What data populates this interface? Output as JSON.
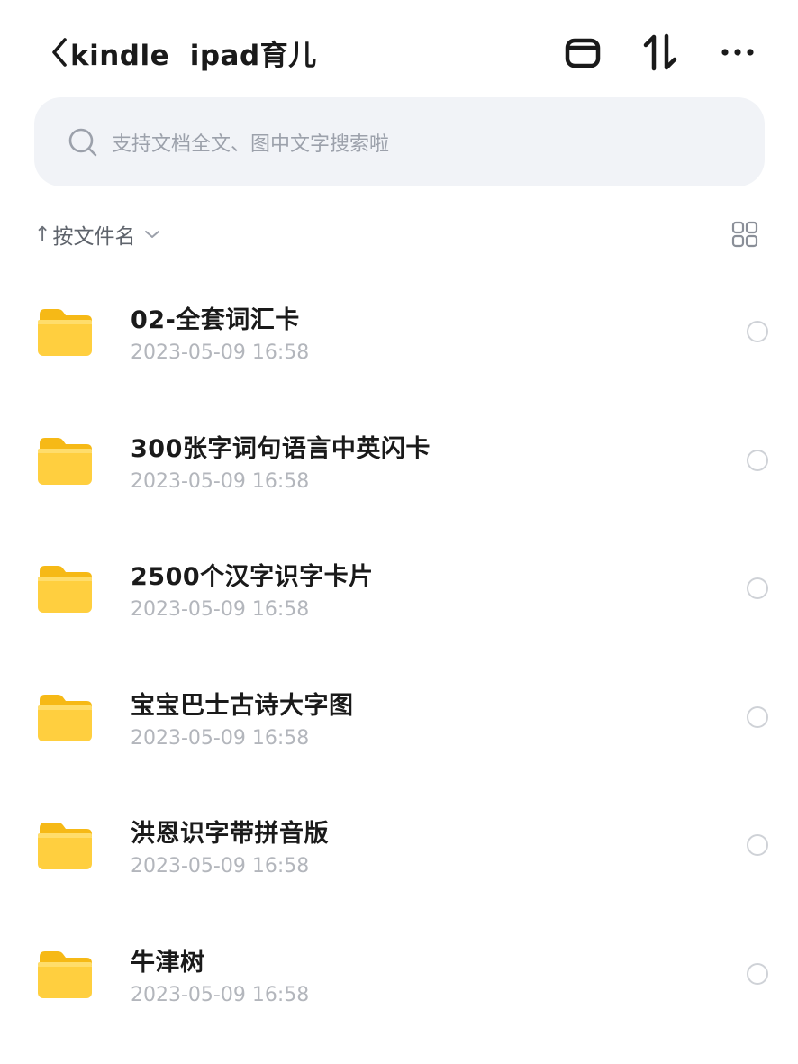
{
  "header": {
    "title": "kindle  ipad育儿",
    "icons": [
      "back-chevron-icon",
      "select-mode-icon",
      "sort-icon",
      "more-icon"
    ]
  },
  "search": {
    "placeholder": "支持文档全文、图中文字搜索啦",
    "icon": "search-icon"
  },
  "sort": {
    "arrow": "↑",
    "label": "按文件名",
    "toggle_icon": "grid-view-icon"
  },
  "colors": {
    "folder": "#ffcf3f",
    "folder_dark": "#f6b916",
    "accent_text": "#1a1a1a",
    "muted_text": "#b3b6bc",
    "search_bg": "#f1f3f7"
  },
  "files": [
    {
      "name": "02-全套词汇卡",
      "date": "2023-05-09 16:58"
    },
    {
      "name": "300张字词句语言中英闪卡",
      "date": "2023-05-09 16:58"
    },
    {
      "name": "2500个汉字识字卡片",
      "date": "2023-05-09 16:58"
    },
    {
      "name": "宝宝巴士古诗大字图",
      "date": "2023-05-09 16:58"
    },
    {
      "name": "洪恩识字带拼音版",
      "date": "2023-05-09 16:58"
    },
    {
      "name": "牛津树",
      "date": "2023-05-09 16:58"
    }
  ]
}
